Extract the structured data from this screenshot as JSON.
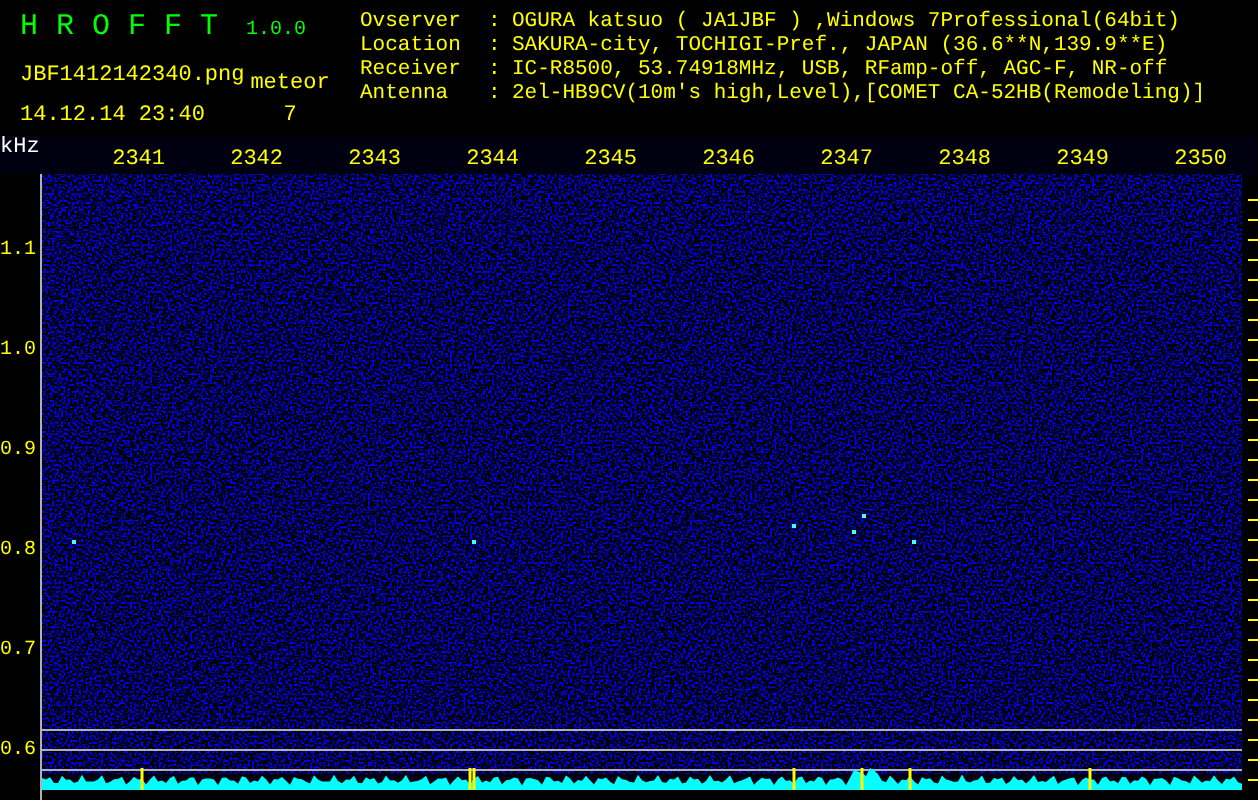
{
  "header": {
    "title": "H R O F F T",
    "version": "1.0.0",
    "filename": "JBF1412142340.png",
    "datetime": "14.12.14 23:40",
    "meteor_label": "meteor",
    "meteor_count": "7",
    "info": [
      {
        "label": "Ovserver",
        "separator": ":",
        "value": "OGURA katsuo ( JA1JBF ) ,Windows 7Professional(64bit)"
      },
      {
        "label": "Location",
        "separator": ":",
        "value": "SAKURA-city, TOCHIGI-Pref., JAPAN (36.6**N,139.9**E)"
      },
      {
        "label": "Receiver",
        "separator": ":",
        "value": "IC-R8500, 53.74918MHz, USB, RFamp-off, AGC-F, NR-off"
      },
      {
        "label": "Antenna",
        "separator": ":",
        "value": "2el-HB9CV(10m's high,Level),[COMET CA-52HB(Remodeling)]"
      }
    ]
  },
  "spectrogram": {
    "unit": "kHz",
    "time_labels": [
      "2341",
      "2342",
      "2343",
      "2344",
      "2345",
      "2346",
      "2347",
      "2348",
      "2349",
      "2350"
    ],
    "freq_labels": [
      "1.1",
      "1.0",
      "0.9",
      "0.8",
      "0.7",
      "0.6"
    ]
  }
}
